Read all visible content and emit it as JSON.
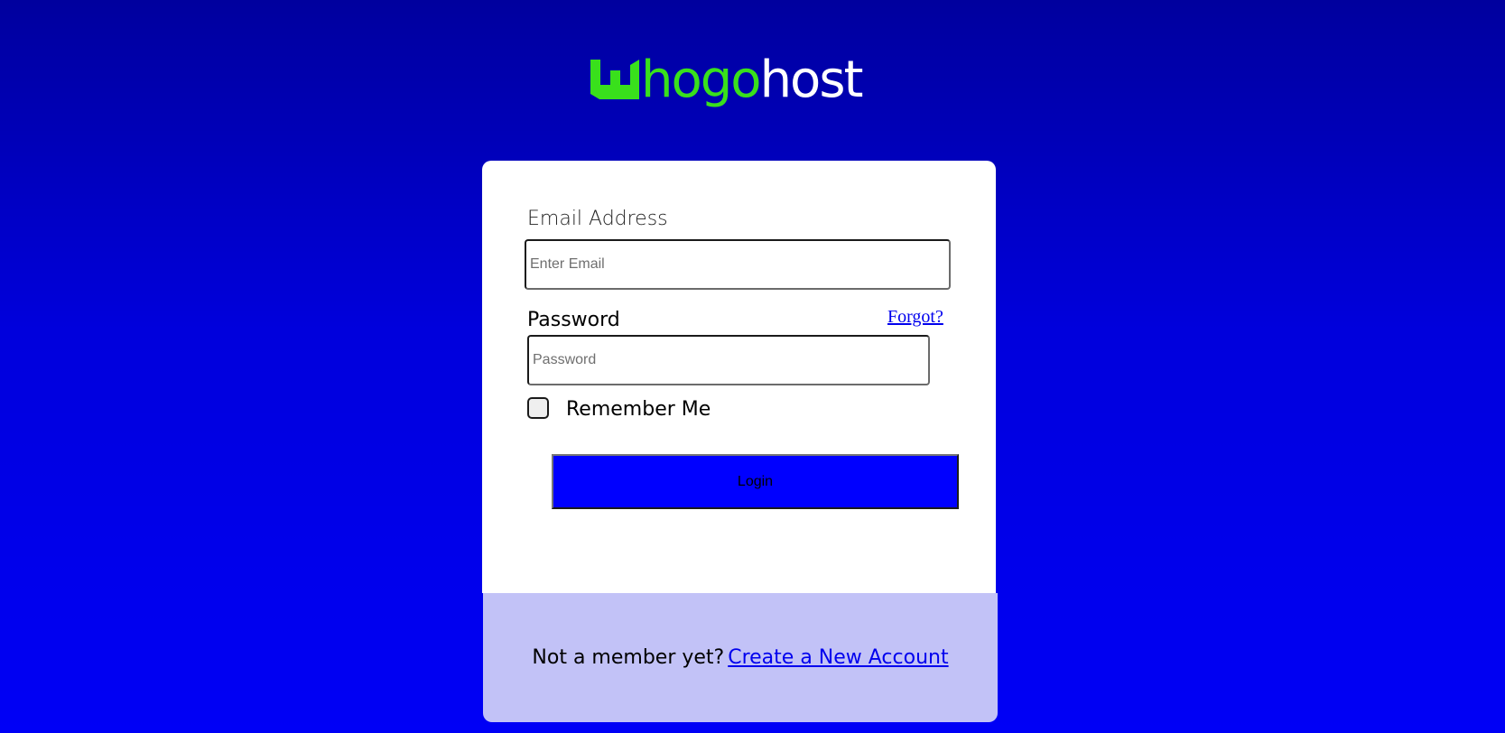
{
  "brand": {
    "logo_part1": "hogo",
    "logo_part2": "host",
    "logo_alt": "Whogohost",
    "green": "#39e01c",
    "white": "#ffffff"
  },
  "form": {
    "email_label": "Email Address",
    "email_placeholder": "Enter Email",
    "email_value": "",
    "password_label": "Password",
    "password_placeholder": "Password",
    "password_value": "",
    "forgot_link": "Forgot?",
    "remember_label": "Remember Me",
    "remember_checked": false,
    "login_button": "Login",
    "login_button_color": "#0000ff"
  },
  "footer": {
    "prompt": "Not a member yet?",
    "signup_link": "Create a New Account"
  },
  "colors": {
    "background_top": "#00009e",
    "background_bottom": "#0000f6",
    "footer_bg": "#c2c2f7",
    "link": "#0000ee"
  }
}
